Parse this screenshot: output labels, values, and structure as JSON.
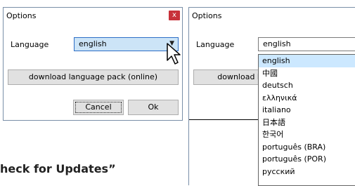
{
  "left_dialog": {
    "title": "Options",
    "close_glyph": "x",
    "language_label": "Language",
    "language_value": "english",
    "download_button": "download language pack (online)",
    "cancel_button": "Cancel",
    "ok_button": "Ok"
  },
  "right_dialog": {
    "title": "Options",
    "language_label": "Language",
    "language_value": "english",
    "download_button_partial": "download l",
    "options": [
      "english",
      "中國",
      "deutsch",
      "ελληνικά",
      "italiano",
      "日本語",
      "한국어",
      "português (BRA)",
      "português (POR)",
      "русский"
    ],
    "selected_index": 0
  },
  "background_heading": "heck for Updates”",
  "colors": {
    "close_red": "#c8313a",
    "focus_blue": "#2d6fc6",
    "selection": "#cce8ff",
    "button_face": "#e1e1e1"
  }
}
